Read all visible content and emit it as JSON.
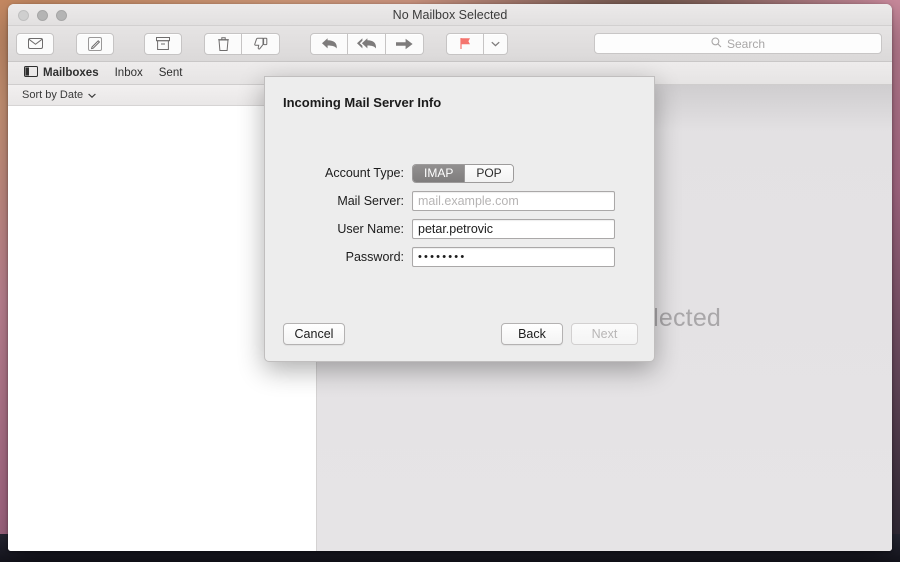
{
  "window": {
    "title": "No Mailbox Selected",
    "traffic_lights": [
      "close",
      "minimize",
      "zoom"
    ]
  },
  "toolbar": {
    "buttons": [
      {
        "name": "get-mail-button",
        "icon": "envelope-icon"
      },
      {
        "name": "compose-button",
        "icon": "compose-icon"
      },
      {
        "name": "archive-button",
        "icon": "archive-box-icon"
      },
      {
        "name": "delete-button",
        "icon": "trash-icon"
      },
      {
        "name": "junk-button",
        "icon": "thumbs-down-icon"
      },
      {
        "name": "reply-button",
        "icon": "reply-arrow-icon"
      },
      {
        "name": "reply-all-button",
        "icon": "reply-all-arrow-icon"
      },
      {
        "name": "forward-button",
        "icon": "forward-arrow-icon"
      },
      {
        "name": "flag-button",
        "icon": "flag-icon"
      },
      {
        "name": "flag-menu-button",
        "icon": "chevron-down-icon"
      }
    ],
    "flag_color": "#f4746e"
  },
  "search": {
    "placeholder": "Search",
    "icon": "search-icon",
    "value": ""
  },
  "mailbox_bar": {
    "items": [
      {
        "label": "Mailboxes",
        "icon": "sidebar-toggle-icon",
        "active": true
      },
      {
        "label": "Inbox",
        "active": false
      },
      {
        "label": "Sent",
        "active": false
      }
    ]
  },
  "message_list": {
    "sort_label": "Sort by Date",
    "sort_icon": "chevron-down-icon",
    "messages": []
  },
  "content": {
    "empty_message": "No Mailbox Selected"
  },
  "sheet": {
    "title": "Incoming Mail Server Info",
    "account_type": {
      "label": "Account Type:",
      "options": [
        "IMAP",
        "POP"
      ],
      "selected": "IMAP"
    },
    "fields": [
      {
        "label": "Mail Server:",
        "value": "",
        "placeholder": "mail.example.com",
        "type": "text"
      },
      {
        "label": "User Name:",
        "value": "petar.petrovic",
        "placeholder": "",
        "type": "text"
      },
      {
        "label": "Password:",
        "value": "••••••••",
        "placeholder": "",
        "type": "password"
      }
    ],
    "buttons": {
      "cancel": "Cancel",
      "back": "Back",
      "next": "Next",
      "next_enabled": false
    }
  }
}
